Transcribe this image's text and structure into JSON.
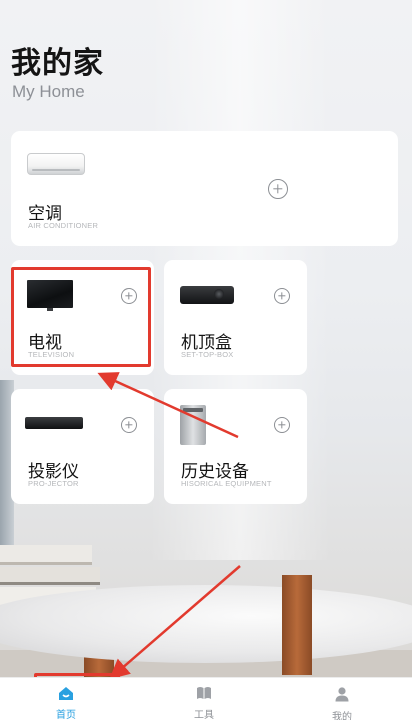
{
  "header": {
    "title": "我的家",
    "subtitle": "My Home"
  },
  "devices": [
    {
      "name": "空调",
      "sub": "AIR CONDITIONER",
      "icon": "air-conditioner"
    },
    {
      "name": "电视",
      "sub": "TELEVISION",
      "icon": "television"
    },
    {
      "name": "机顶盒",
      "sub": "SET-TOP-BOX",
      "icon": "set-top-box"
    },
    {
      "name": "投影仪",
      "sub": "PRO-JECTOR",
      "icon": "projector"
    },
    {
      "name": "历史设备",
      "sub": "HISORICAL EQUIPMENT",
      "icon": "history-device"
    }
  ],
  "tabbar": {
    "items": [
      {
        "label": "首页",
        "icon": "home-icon",
        "active": true
      },
      {
        "label": "工具",
        "icon": "book-icon",
        "active": false
      },
      {
        "label": "我的",
        "icon": "user-icon",
        "active": false
      }
    ]
  },
  "colors": {
    "accent": "#29a0e0",
    "annotation": "#e23a2e"
  }
}
